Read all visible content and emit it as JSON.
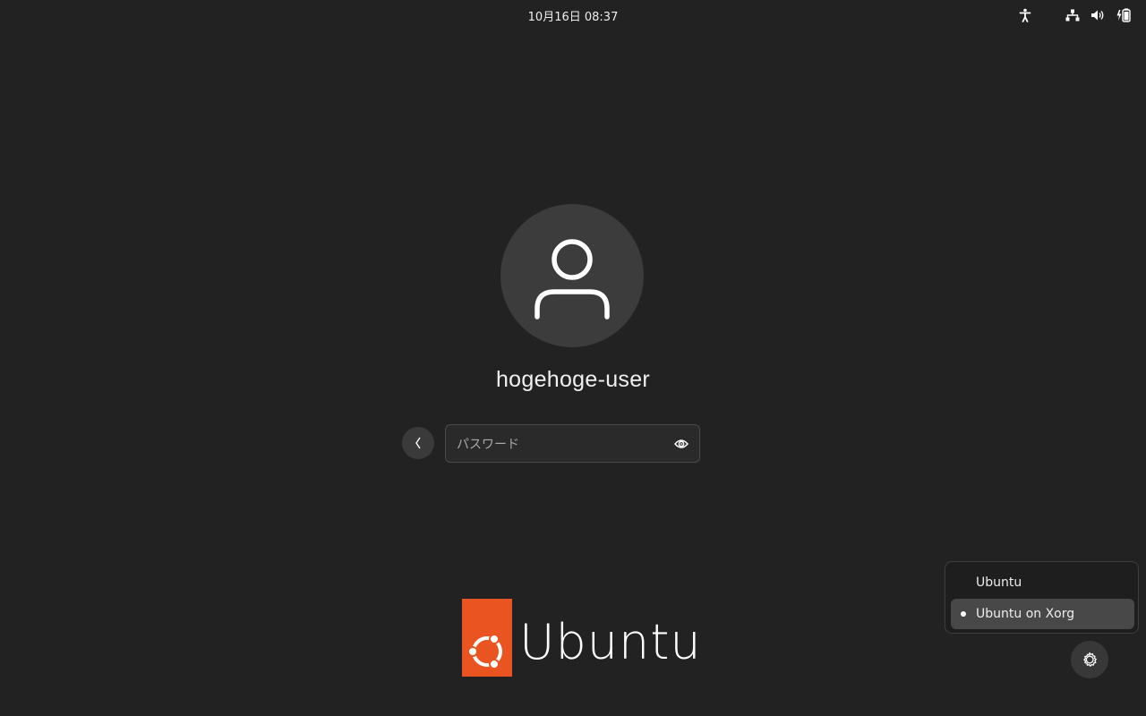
{
  "topbar": {
    "clock": "10月16日  08:37",
    "icons": [
      "accessibility-icon",
      "network-wired-icon",
      "volume-icon",
      "battery-icon"
    ]
  },
  "user": {
    "name": "hogehoge-user",
    "avatar_icon": "user-avatar-icon"
  },
  "login": {
    "back_icon": "chevron-left-icon",
    "password_placeholder": "パスワード",
    "password_value": "",
    "reveal_icon": "eye-icon"
  },
  "branding": {
    "logo_text": "Ubuntu",
    "logo_color": "#e95420"
  },
  "session_menu": {
    "items": [
      {
        "label": "Ubuntu",
        "selected": false
      },
      {
        "label": "Ubuntu on Xorg",
        "selected": true
      }
    ],
    "settings_icon": "gear-icon"
  },
  "colors": {
    "background": "#222222",
    "accent": "#e95420"
  }
}
